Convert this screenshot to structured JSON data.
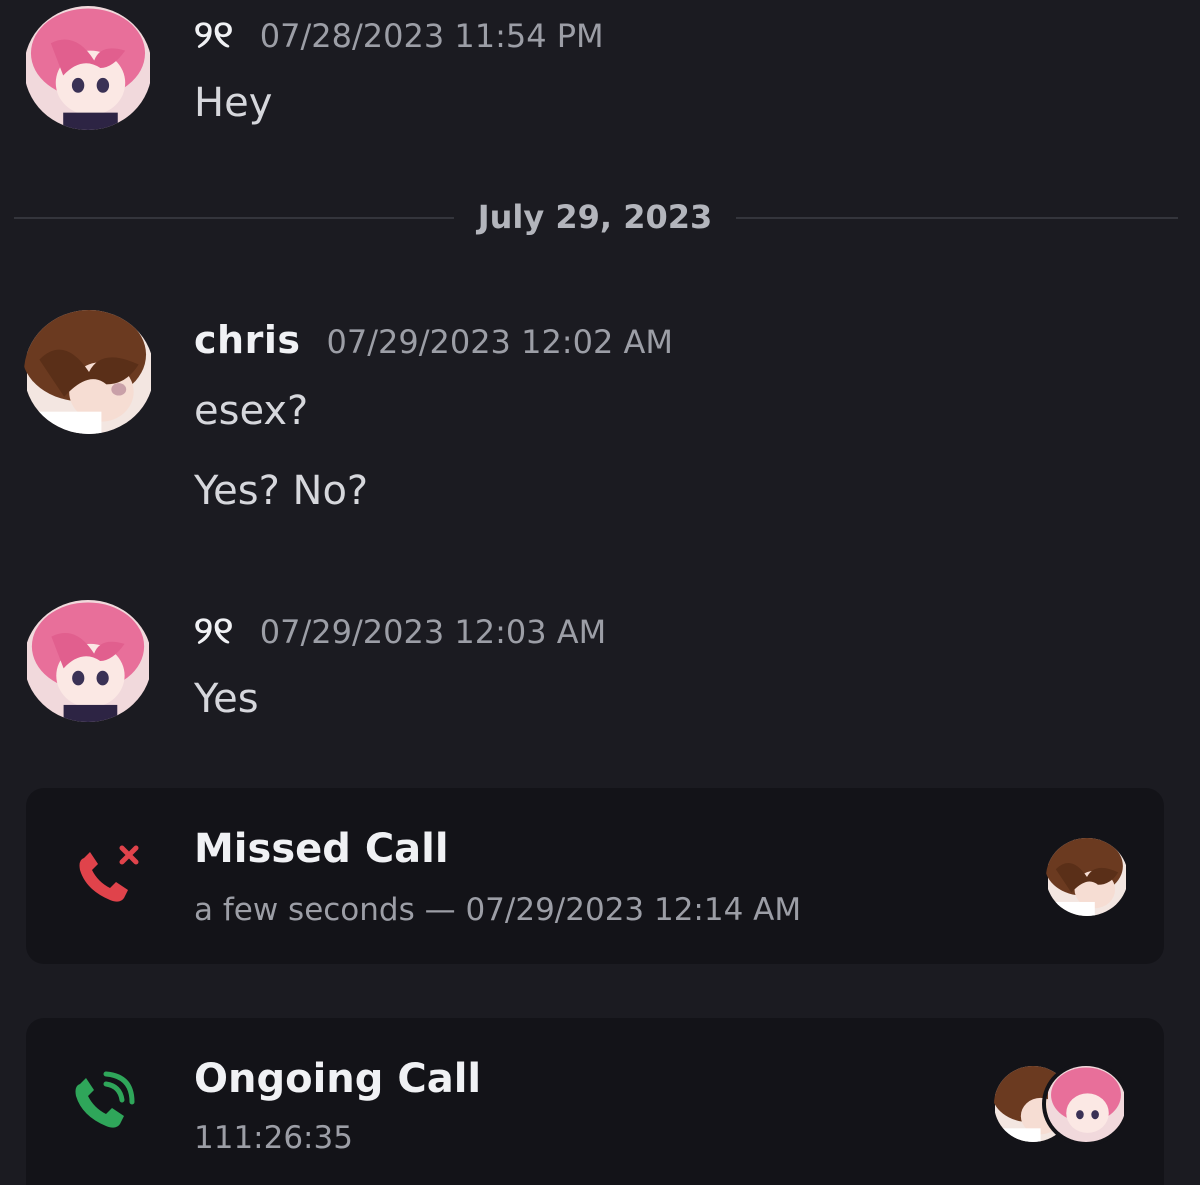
{
  "messages": [
    {
      "author": "୨୧",
      "timestamp": "07/28/2023 11:54 PM",
      "lines": [
        "Hey"
      ]
    },
    {
      "author": "chris",
      "timestamp": "07/29/2023 12:02 AM",
      "lines": [
        "esex?",
        "Yes? No?"
      ]
    },
    {
      "author": "୨୧",
      "timestamp": "07/29/2023 12:03 AM",
      "lines": [
        "Yes"
      ]
    }
  ],
  "date_divider": "July 29, 2023",
  "calls": [
    {
      "title": "Missed Call",
      "subtitle": "a few seconds — 07/29/2023 12:14 AM",
      "icon": "missed-call-icon"
    },
    {
      "title": "Ongoing Call",
      "subtitle": "111:26:35",
      "icon": "ongoing-call-icon"
    }
  ],
  "colors": {
    "background": "#1b1b21",
    "card": "#131318",
    "missed": "#e0434b",
    "ongoing": "#2fa65a"
  }
}
